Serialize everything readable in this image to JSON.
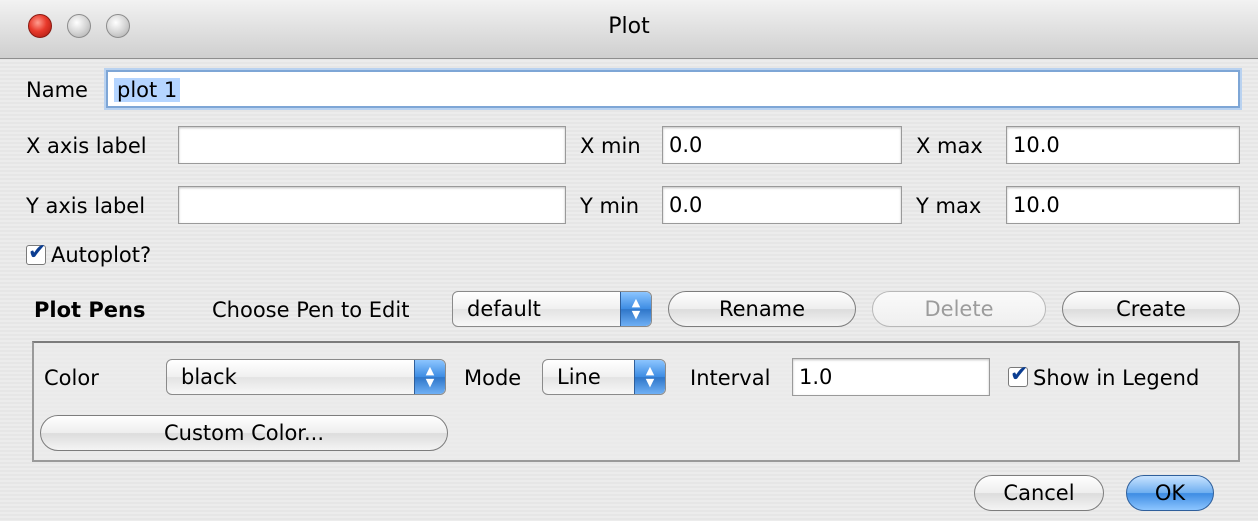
{
  "window": {
    "title": "Plot"
  },
  "form": {
    "name_label": "Name",
    "name_value": "plot 1",
    "x_axis_label": "X axis label",
    "x_axis_value": "",
    "x_min_label": "X min",
    "x_min_value": "0.0",
    "x_max_label": "X max",
    "x_max_value": "10.0",
    "y_axis_label": "Y axis label",
    "y_axis_value": "",
    "y_min_label": "Y min",
    "y_min_value": "0.0",
    "y_max_label": "Y max",
    "y_max_value": "10.0",
    "autoplot_label": "Autoplot?",
    "autoplot_checked": true
  },
  "pens": {
    "section_label": "Plot Pens",
    "choose_label": "Choose Pen to Edit",
    "selected_pen": "default",
    "rename_label": "Rename",
    "delete_label": "Delete",
    "create_label": "Create",
    "color_label": "Color",
    "color_value": "black",
    "mode_label": "Mode",
    "mode_value": "Line",
    "interval_label": "Interval",
    "interval_value": "1.0",
    "legend_label": "Show in Legend",
    "legend_checked": true,
    "custom_color_label": "Custom Color..."
  },
  "footer": {
    "cancel_label": "Cancel",
    "ok_label": "OK"
  },
  "colors": {
    "accent": "#3d8ce3",
    "focus_ring": "#7ea6d6",
    "close_button": "#e8392b"
  }
}
